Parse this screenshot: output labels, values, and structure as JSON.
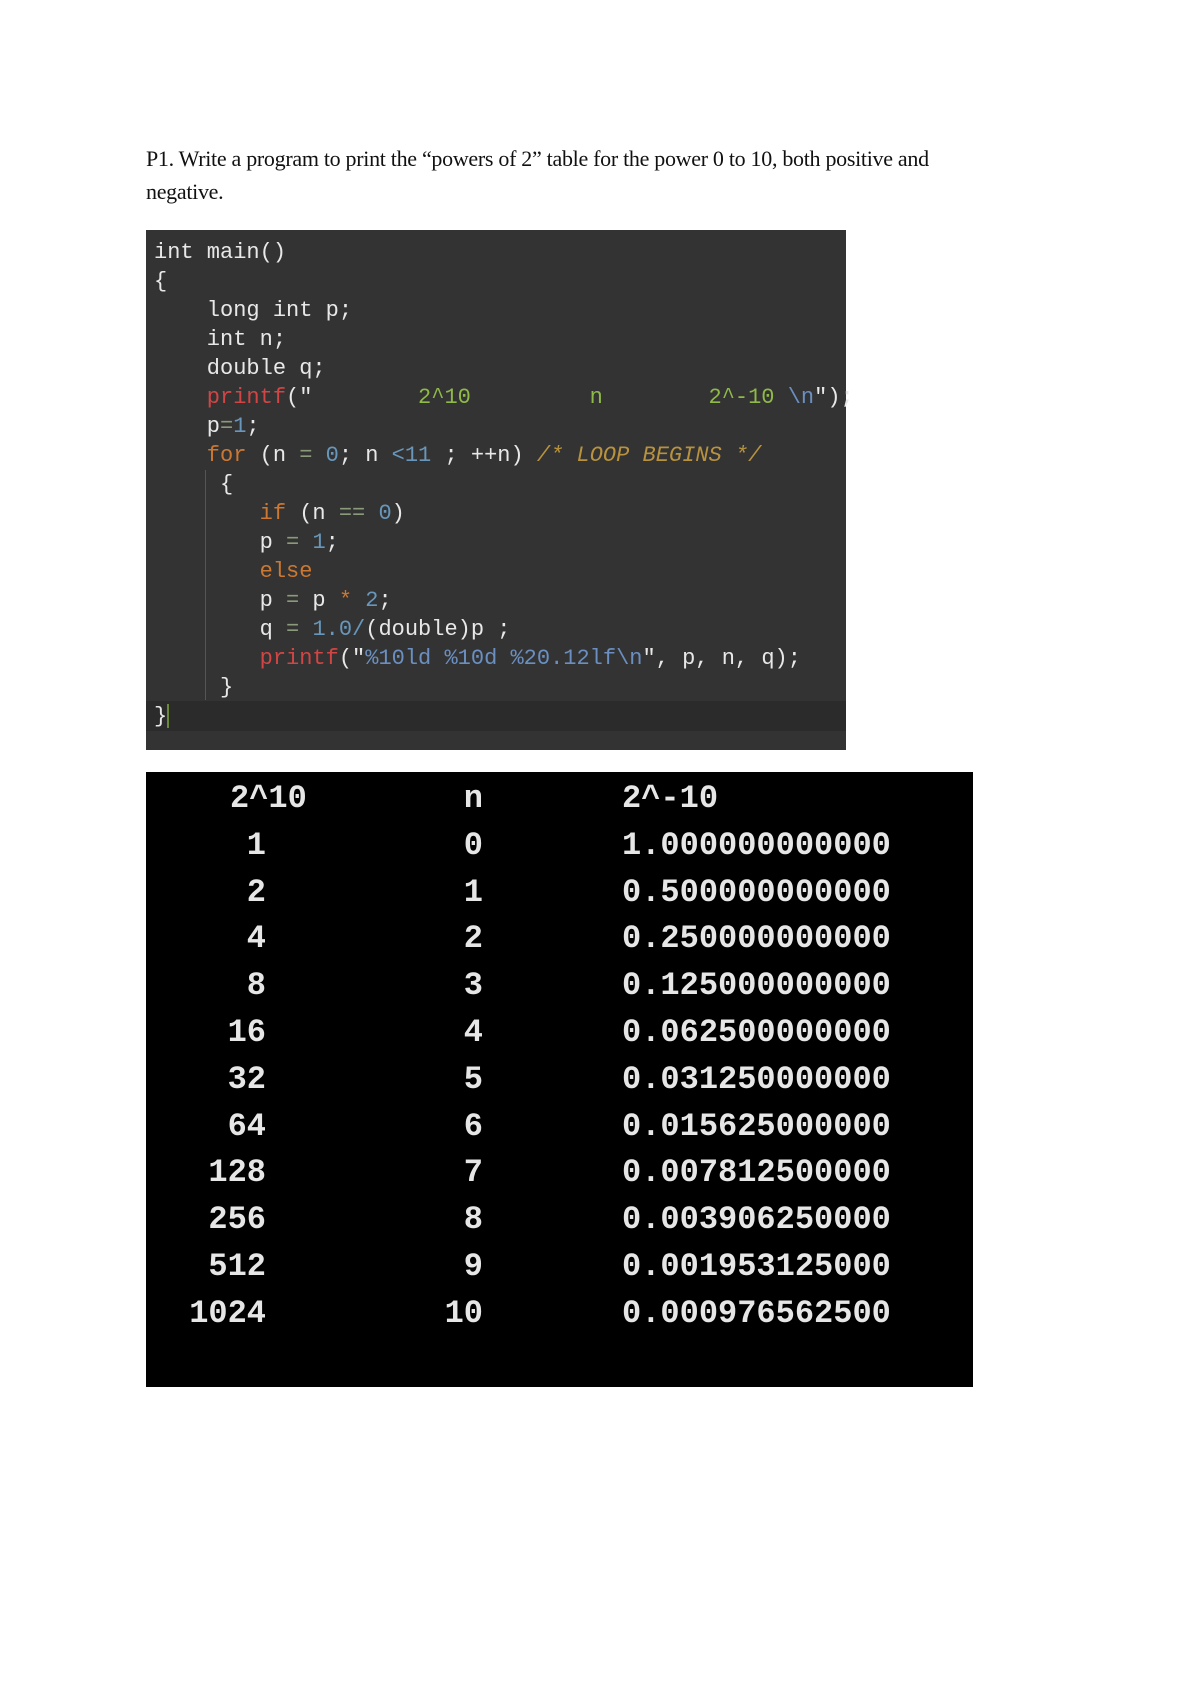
{
  "question": {
    "line1": "P1.  Write a program to print the “powers of 2” table for the power 0 to 10, both positive and",
    "line2": "negative."
  },
  "code": [
    [
      [
        "int main()",
        ""
      ]
    ],
    [
      [
        "{",
        ""
      ]
    ],
    [
      [
        "    long int p;",
        ""
      ]
    ],
    [
      [
        "    int n;",
        ""
      ]
    ],
    [
      [
        "    double q;",
        ""
      ]
    ],
    [
      [
        "    printf",
        "t-fn"
      ],
      [
        "(\"",
        ""
      ],
      [
        "        2^10         n        2^-10 ",
        "t-str"
      ],
      [
        "\\n",
        "t-esc"
      ],
      [
        "\");",
        ""
      ]
    ],
    [
      [
        "    p",
        ""
      ],
      [
        "=",
        "t-op"
      ],
      [
        "1",
        "t-num"
      ],
      [
        ";",
        ""
      ]
    ],
    [
      [
        "    for",
        "t-kw"
      ],
      [
        " (n ",
        ""
      ],
      [
        "=",
        "t-op"
      ],
      [
        " ",
        ""
      ],
      [
        "0",
        "t-num"
      ],
      [
        "; n ",
        ""
      ],
      [
        "<11",
        "t-num"
      ],
      [
        " ; ++n) ",
        ""
      ],
      [
        "/* LOOP BEGINS */",
        "t-cm"
      ]
    ],
    [
      [
        "     {",
        ""
      ]
    ],
    [
      [
        "        if",
        "t-kw"
      ],
      [
        " (n ",
        ""
      ],
      [
        "==",
        "t-op"
      ],
      [
        " ",
        ""
      ],
      [
        "0",
        "t-num"
      ],
      [
        ")",
        ""
      ]
    ],
    [
      [
        "        p ",
        ""
      ],
      [
        "=",
        "t-op"
      ],
      [
        " ",
        ""
      ],
      [
        "1",
        "t-num"
      ],
      [
        ";",
        ""
      ]
    ],
    [
      [
        "        else",
        "t-kw"
      ]
    ],
    [
      [
        "        p ",
        ""
      ],
      [
        "=",
        "t-op"
      ],
      [
        " p ",
        ""
      ],
      [
        "*",
        "t-kw"
      ],
      [
        " ",
        ""
      ],
      [
        "2",
        "t-num"
      ],
      [
        ";",
        ""
      ]
    ],
    [
      [
        "        q ",
        ""
      ],
      [
        "=",
        "t-op"
      ],
      [
        " ",
        ""
      ],
      [
        "1.0/",
        "t-num"
      ],
      [
        "(double)p ;",
        ""
      ]
    ],
    [
      [
        "        printf",
        "t-fn"
      ],
      [
        "(\"",
        ""
      ],
      [
        "%10ld %10d %20.12lf",
        "t-fmt"
      ],
      [
        "\\n",
        "t-esc"
      ],
      [
        "\", p, n, q);",
        ""
      ]
    ],
    [
      [
        "     }",
        ""
      ]
    ],
    [
      [
        "}",
        ""
      ]
    ]
  ],
  "output": {
    "header": [
      "2^10",
      "n",
      "2^-10"
    ],
    "rows": [
      [
        "1",
        "0",
        "1.000000000000"
      ],
      [
        "2",
        "1",
        "0.500000000000"
      ],
      [
        "4",
        "2",
        "0.250000000000"
      ],
      [
        "8",
        "3",
        "0.125000000000"
      ],
      [
        "16",
        "4",
        "0.062500000000"
      ],
      [
        "32",
        "5",
        "0.031250000000"
      ],
      [
        "64",
        "6",
        "0.015625000000"
      ],
      [
        "128",
        "7",
        "0.007812500000"
      ],
      [
        "256",
        "8",
        "0.003906250000"
      ],
      [
        "512",
        "9",
        "0.001953125000"
      ],
      [
        "1024",
        "10",
        "0.000976562500"
      ]
    ]
  }
}
